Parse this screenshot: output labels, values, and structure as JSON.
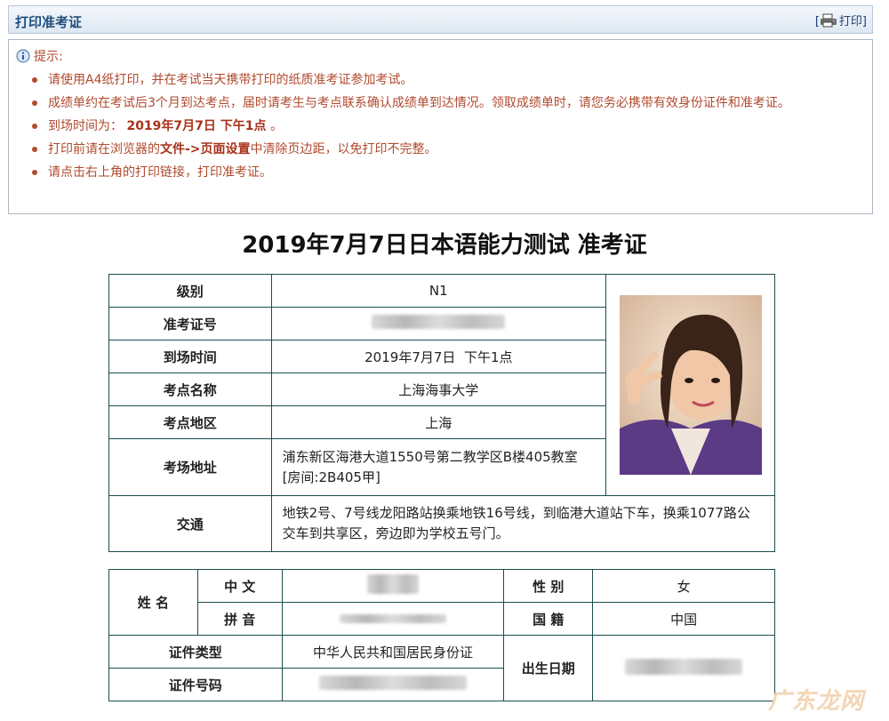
{
  "header": {
    "title": "打印准考证",
    "print_label": "打印"
  },
  "tips": {
    "heading": "提示:",
    "items": [
      "请使用A4纸打印，并在考试当天携带打印的纸质准考证参加考试。",
      "成绩单约在考试后3个月到达考点，届时请考生与考点联系确认成绩单到达情况。领取成绩单时，请您务必携带有效身份证件和准考证。"
    ],
    "arrival_prefix": "到场时间为：",
    "arrival_time": "2019年7月7日 下午1点",
    "arrival_suffix": "。",
    "print_tip_prefix": "打印前请在浏览器的",
    "print_tip_file": "文件->页面设置",
    "print_tip_suffix": "中清除页边距，以免打印不完整。",
    "last_item": "请点击右上角的打印链接，打印准考证。"
  },
  "title": "2019年7月7日日本语能力测试 准考证",
  "exam_info": {
    "level_label": "级别",
    "level": "N1",
    "ticket_label": "准考证号",
    "arrival_label": "到场时间",
    "arrival": "2019年7月7日  下午1点",
    "site_label": "考点名称",
    "site": "上海海事大学",
    "region_label": "考点地区",
    "region": "上海",
    "address_label": "考场地址",
    "address": "浦东新区海港大道1550号第二教学区B楼405教室 [房间:2B405甲]",
    "transport_label": "交通",
    "transport": "地铁2号、7号线龙阳路站换乘地铁16号线，到临港大道站下车，换乘1077路公交车到共享区，旁边即为学校五号门。"
  },
  "personal": {
    "name_label": "姓 名",
    "chinese_label": "中 文",
    "pinyin_label": "拼 音",
    "gender_label": "性 别",
    "gender": "女",
    "nationality_label": "国 籍",
    "nationality": "中国",
    "id_type_label": "证件类型",
    "id_type": "中华人民共和国居民身份证",
    "id_no_label": "证件号码",
    "birth_label": "出生日期"
  },
  "watermark": "广东龙网",
  "colors": {
    "tip_text": "#b04a2e",
    "header_title": "#1f4f7c",
    "table_border": "#1d4d4d"
  }
}
